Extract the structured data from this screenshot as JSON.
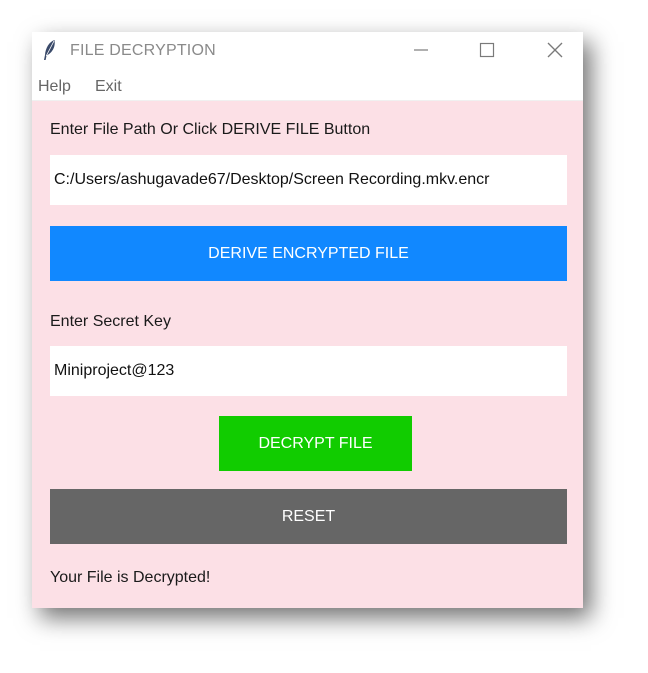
{
  "window": {
    "title": "FILE DECRYPTION",
    "controls": {
      "minimize": "minimize",
      "maximize": "maximize",
      "close": "close"
    }
  },
  "menu": {
    "items": [
      {
        "label": "Help"
      },
      {
        "label": "Exit"
      }
    ]
  },
  "form": {
    "path_label": "Enter File Path Or Click DERIVE FILE Button",
    "path_value": "C:/Users/ashugavade67/Desktop/Screen Recording.mkv.encr",
    "derive_button": "DERIVE ENCRYPTED FILE",
    "key_label": "Enter Secret Key",
    "key_value": "Miniproject@123",
    "decrypt_button": "DECRYPT FILE",
    "reset_button": "RESET",
    "status": "Your File is Decrypted!"
  },
  "colors": {
    "window_bg": "#fce0e6",
    "derive_button": "#1188ff",
    "decrypt_button": "#11cc00",
    "reset_button": "#666666"
  },
  "icons": {
    "app": "feather-icon",
    "minimize": "minimize-icon",
    "maximize": "maximize-icon",
    "close": "close-icon"
  }
}
